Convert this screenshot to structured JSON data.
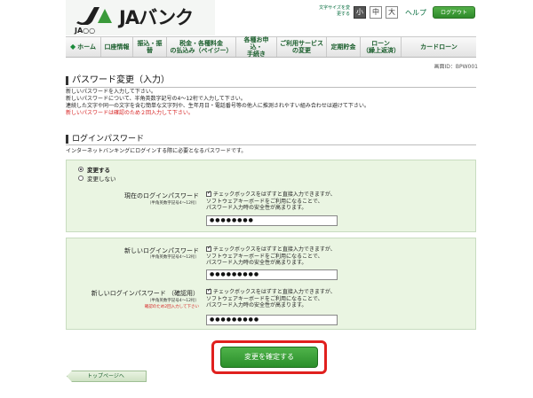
{
  "header": {
    "logo_text": "JAバンク",
    "logo_sub": "JA○○",
    "font_size_label": "文字サイズを変更する",
    "font_sizes": [
      "小",
      "中",
      "大"
    ],
    "help": "ヘルプ",
    "logout": "ログアウト",
    "brand_color": "#1f1f1f",
    "accent_color": "#2f8a2b"
  },
  "nav": {
    "items": [
      {
        "label": "ホーム",
        "icon": "home-icon"
      },
      {
        "label": "口座情報"
      },
      {
        "label": "振込・振替"
      },
      {
        "label": "税金・各種料金\nの払込み（ペイジー）"
      },
      {
        "label": "各種お申込・\n手続き"
      },
      {
        "label": "ご利用サービス\nの変更"
      },
      {
        "label": "定期貯金"
      },
      {
        "label": "ローン\n（繰上返済）"
      },
      {
        "label": "カードローン"
      }
    ]
  },
  "screen_id": "画面ID：BPW001",
  "page": {
    "title": "パスワード変更（入力）",
    "desc_lines": [
      "新しいパスワードを入力して下さい。",
      "新しいパスワードについて、半角英数字記号の4～12桁で入力して下さい。",
      "連続した文字や同一の文字を含む簡単な文字列や、生年月日・電話番号等の他人に推測されやすい組み合わせは避けて下さい。"
    ],
    "desc_red": "新しいパスワードは確認のため２回入力して下さい。"
  },
  "login_pw": {
    "section_title": "ログインパスワード",
    "section_desc": "インターネットバンキングにログインする際に必要となるパスワードです。",
    "radio_change": "変更する",
    "radio_nochange": "変更しない",
    "current_label": "現在のログインパスワード",
    "hint": "（半角英数字記号4～12桁）",
    "check_line1": "チェックボックスをはずすと直接入力できますが、",
    "check_line2": "ソフトウェアキーボードをご利用になることで、",
    "check_line3": "パスワード入力時の安全性が高まります。",
    "current_value": "●●●●●●●●",
    "new_label": "新しいログインパスワード",
    "new_value": "●●●●●●●●●",
    "confirm_label": "新しいログインパスワード （確認用）",
    "confirm_hint_red": "確認のため2回入力して下さい",
    "confirm_value": "●●●●●●●●●"
  },
  "actions": {
    "confirm": "変更を確定する",
    "top_page": "トップページへ",
    "highlight_color": "#e0201e"
  }
}
